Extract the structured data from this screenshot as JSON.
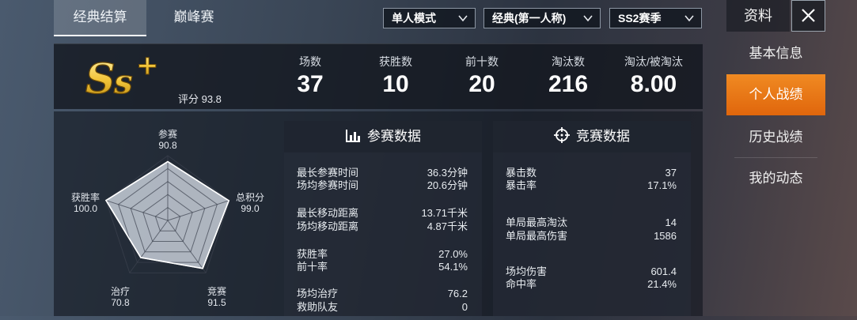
{
  "tabs": [
    "经典结算",
    "巅峰赛"
  ],
  "filters": {
    "mode": "单人模式",
    "map": "经典(第一人称)",
    "season": "SS2赛季"
  },
  "side": {
    "title": "资料",
    "items": [
      "基本信息",
      "个人战绩",
      "历史战绩",
      "我的动态"
    ],
    "active_index": 1
  },
  "rank": {
    "badge": "Ss+",
    "score_label": "评分 93.8"
  },
  "summary": [
    {
      "label": "场数",
      "value": "37"
    },
    {
      "label": "获胜数",
      "value": "10"
    },
    {
      "label": "前十数",
      "value": "20"
    },
    {
      "label": "淘汰数",
      "value": "216"
    },
    {
      "label": "淘汰/被淘汰",
      "value": "8.00"
    }
  ],
  "radar": {
    "axes": [
      {
        "name": "参赛",
        "value": "90.8"
      },
      {
        "name": "总积分",
        "value": "99.0"
      },
      {
        "name": "竞赛",
        "value": "91.5"
      },
      {
        "name": "治疗",
        "value": "70.8"
      },
      {
        "name": "获胜率",
        "value": "100.0"
      }
    ],
    "levels": [
      90.8,
      99.0,
      91.5,
      70.8,
      100.0
    ]
  },
  "participation": {
    "title": "参赛数据",
    "icon": "bar-chart-icon",
    "rows": [
      {
        "label": "最长参赛时间",
        "value": "36.3分钟"
      },
      {
        "label": "场均参赛时间",
        "value": "20.6分钟"
      },
      {
        "label": "最长移动距离",
        "value": "13.71千米"
      },
      {
        "label": "场均移动距离",
        "value": "4.87千米"
      },
      {
        "label": "获胜率",
        "value": "27.0%"
      },
      {
        "label": "前十率",
        "value": "54.1%"
      },
      {
        "label": "场均治疗",
        "value": "76.2"
      },
      {
        "label": "救助队友",
        "value": "0"
      }
    ]
  },
  "combat": {
    "title": "竞赛数据",
    "icon": "crosshair-icon",
    "rows": [
      {
        "label": "暴击数",
        "value": "37"
      },
      {
        "label": "暴击率",
        "value": "17.1%"
      },
      {
        "label": "单局最高淘汰",
        "value": "14"
      },
      {
        "label": "单局最高伤害",
        "value": "1586"
      },
      {
        "label": "场均伤害",
        "value": "601.4"
      },
      {
        "label": "命中率",
        "value": "21.4%"
      }
    ]
  },
  "colors": {
    "accent": "#ec7a18",
    "badge_gold": "#f2c53a"
  }
}
